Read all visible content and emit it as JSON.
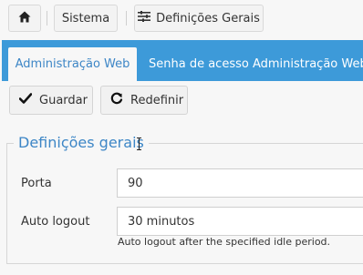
{
  "breadcrumb": {
    "home_icon": "home-icon",
    "items": [
      "Sistema",
      "Definições Gerais"
    ],
    "settings_icon": "sliders-icon"
  },
  "tabs": [
    {
      "label": "Administração Web",
      "active": true
    },
    {
      "label": "Senha de acesso Administração Web",
      "active": false
    }
  ],
  "toolbar": {
    "save_label": "Guardar",
    "reset_label": "Redefinir"
  },
  "section": {
    "title": "Definições gerais",
    "fields": [
      {
        "label": "Porta",
        "value": "90"
      },
      {
        "label": "Auto logout",
        "value": "30 minutos",
        "help": "Auto logout after the specified idle period."
      }
    ]
  },
  "colors": {
    "accent": "#3d9ad9",
    "accent_text": "#3d86c6",
    "background": "#f7f7f7"
  }
}
